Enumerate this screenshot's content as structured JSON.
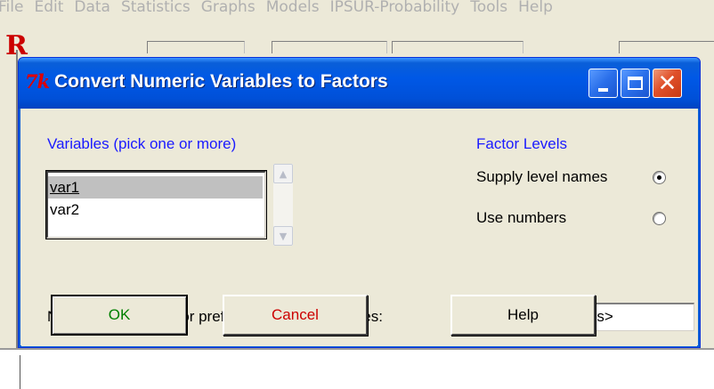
{
  "background_app": {
    "menu": [
      "File",
      "Edit",
      "Data",
      "Statistics",
      "Graphs",
      "Models",
      "IPSUR-Probability",
      "Tools",
      "Help"
    ],
    "logo_letter": "R"
  },
  "dialog": {
    "icon_text": "7k",
    "title": "Convert Numeric Variables to Factors",
    "variables_label": "Variables (pick one or more)",
    "variables": [
      {
        "label": "var1",
        "selected": true
      },
      {
        "label": "var2",
        "selected": false
      }
    ],
    "factor_levels_label": "Factor Levels",
    "factor_options": [
      {
        "label": "Supply level names",
        "checked": true
      },
      {
        "label": "Use numbers",
        "checked": false
      }
    ],
    "prefix_label": "New variable name or prefix for multiple variables:",
    "prefix_value": "<same as variables>",
    "ok_label": "OK",
    "cancel_label": "Cancel",
    "help_label": "Help"
  },
  "colors": {
    "title_bar": "#0058e6",
    "blue_label": "#1a1aff",
    "ok_text": "#008000",
    "cancel_text": "#cc0000",
    "close_button": "#e0502a"
  }
}
